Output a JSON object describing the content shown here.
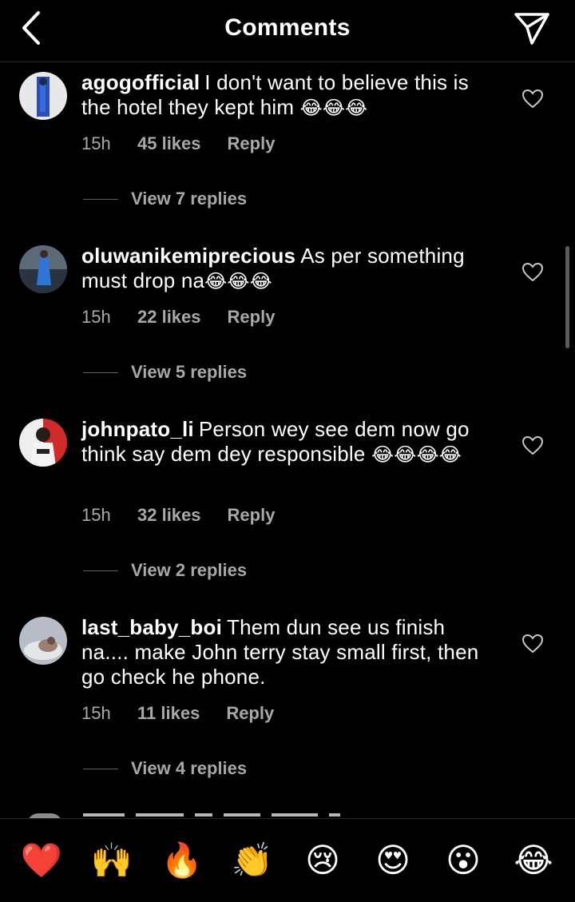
{
  "header": {
    "title": "Comments",
    "back_icon": "back-chevron-icon",
    "send_icon": "paper-plane-icon"
  },
  "comments": [
    {
      "username": "agogofficial",
      "text": "I don't want to believe this is the hotel they kept him",
      "emojis": "😂😂😂",
      "time": "15h",
      "likes": "45 likes",
      "reply": "Reply",
      "view_replies": "View 7 replies"
    },
    {
      "username": "oluwanikemiprecious",
      "text": "As per something must drop na",
      "emojis": "😂😂😂",
      "time": "15h",
      "likes": "22 likes",
      "reply": "Reply",
      "view_replies": "View 5 replies"
    },
    {
      "username": "johnpato_li",
      "text": "Person wey see dem now go think say dem dey responsible",
      "emojis": "😂😂😂😂",
      "time": "15h",
      "likes": "32 likes",
      "reply": "Reply",
      "view_replies": "View 2 replies"
    },
    {
      "username": "last_baby_boi",
      "text": "Them dun see us finish na.... make John terry stay small first, then go check he phone.",
      "emojis": "",
      "time": "15h",
      "likes": "11 likes",
      "reply": "Reply",
      "view_replies": "View 4 replies"
    }
  ],
  "reactions": [
    "❤️",
    "🙌",
    "🔥",
    "👏",
    "😢",
    "😍",
    "😮",
    "😂"
  ],
  "colors": {
    "background": "#000000",
    "text": "#ffffff",
    "meta": "#a8a8a8",
    "divider": "#262626"
  }
}
